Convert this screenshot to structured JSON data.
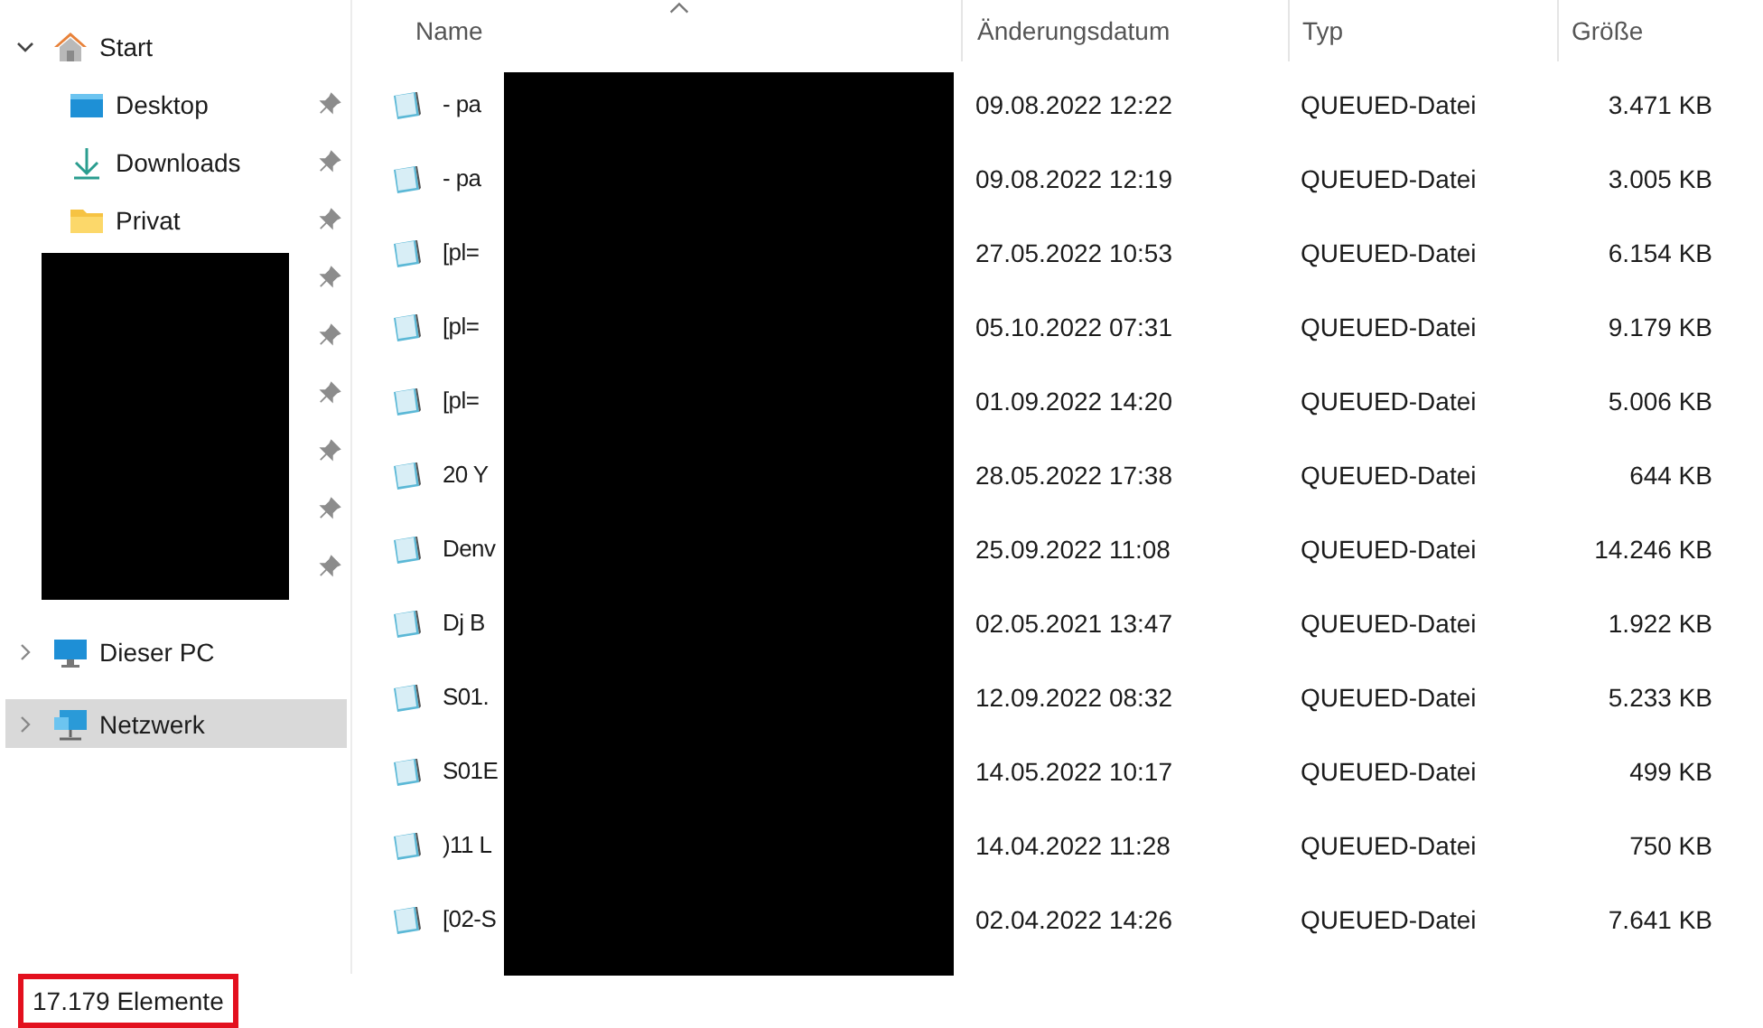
{
  "sidebar": {
    "start": {
      "label": "Start",
      "expanded": true
    },
    "quick_access": [
      {
        "label": "Desktop",
        "pinned": true
      },
      {
        "label": "Downloads",
        "pinned": true
      },
      {
        "label": "Privat",
        "pinned": true
      },
      {
        "pinned": true,
        "redacted": true
      },
      {
        "pinned": true,
        "redacted": true
      },
      {
        "pinned": true,
        "redacted": true
      },
      {
        "pinned": true,
        "redacted": true
      },
      {
        "pinned": true,
        "redacted": true
      },
      {
        "pinned": true,
        "redacted": true
      }
    ],
    "locations": [
      {
        "label": "Dieser PC",
        "expanded": false,
        "selected": false
      },
      {
        "label": "Netzwerk",
        "expanded": false,
        "selected": true
      }
    ]
  },
  "file_list": {
    "columns": [
      {
        "label": "Name",
        "sorted": true
      },
      {
        "label": "Änderungsdatum",
        "sorted": false
      },
      {
        "label": "Typ",
        "sorted": false
      },
      {
        "label": "Größe",
        "sorted": false
      }
    ],
    "redacted": true,
    "rows": [
      {
        "name": "- pa",
        "date": "09.08.2022 12:22",
        "type": "QUEUED-Datei",
        "size": "3.471 KB"
      },
      {
        "name": "- pa",
        "date": "09.08.2022 12:19",
        "type": "QUEUED-Datei",
        "size": "3.005 KB"
      },
      {
        "name": "[pl=",
        "date": "27.05.2022 10:53",
        "type": "QUEUED-Datei",
        "size": "6.154 KB"
      },
      {
        "name": "[pl=",
        "date": "05.10.2022 07:31",
        "type": "QUEUED-Datei",
        "size": "9.179 KB"
      },
      {
        "name": "[pl=",
        "date": "01.09.2022 14:20",
        "type": "QUEUED-Datei",
        "size": "5.006 KB"
      },
      {
        "name": "20 Y",
        "date": "28.05.2022 17:38",
        "type": "QUEUED-Datei",
        "size": "644 KB"
      },
      {
        "name": "Denv",
        "date": "25.09.2022 11:08",
        "type": "QUEUED-Datei",
        "size": "14.246 KB"
      },
      {
        "name": "Dj B",
        "date": "02.05.2021 13:47",
        "type": "QUEUED-Datei",
        "size": "1.922 KB"
      },
      {
        "name": "S01.",
        "date": "12.09.2022 08:32",
        "type": "QUEUED-Datei",
        "size": "5.233 KB"
      },
      {
        "name": "S01E",
        "date": "14.05.2022 10:17",
        "type": "QUEUED-Datei",
        "size": "499 KB"
      },
      {
        "name": ")11 L",
        "date": "14.04.2022 11:28",
        "type": "QUEUED-Datei",
        "size": "750 KB"
      },
      {
        "name": "[02-S",
        "date": "02.04.2022 14:26",
        "type": "QUEUED-Datei",
        "size": "7.641 KB"
      }
    ]
  },
  "status_bar": {
    "item_count": "17.179 Elemente",
    "highlighted": true
  }
}
